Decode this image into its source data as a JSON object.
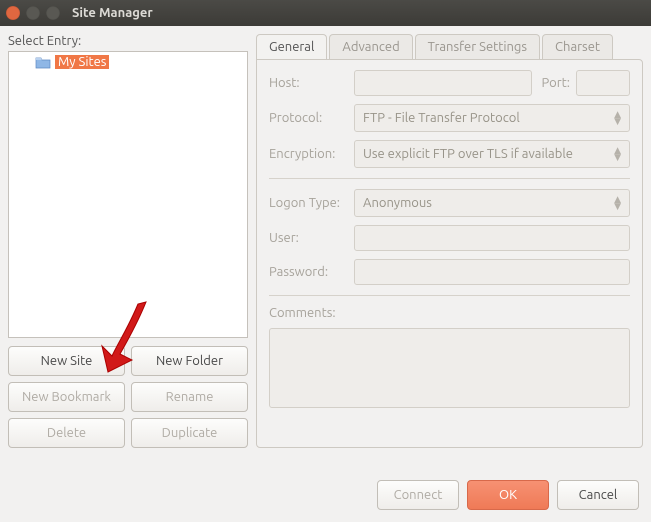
{
  "title": "Site Manager",
  "left": {
    "select_entry_label": "Select Entry:",
    "tree_root": "My Sites",
    "buttons": {
      "new_site": "New Site",
      "new_folder": "New Folder",
      "new_bookmark": "New Bookmark",
      "rename": "Rename",
      "delete": "Delete",
      "duplicate": "Duplicate"
    }
  },
  "tabs": {
    "general": "General",
    "advanced": "Advanced",
    "transfer": "Transfer Settings",
    "charset": "Charset"
  },
  "form": {
    "host_label": "Host:",
    "port_label": "Port:",
    "protocol_label": "Protocol:",
    "protocol_value": "FTP - File Transfer Protocol",
    "encryption_label": "Encryption:",
    "encryption_value": "Use explicit FTP over TLS if available",
    "logon_type_label": "Logon Type:",
    "logon_type_value": "Anonymous",
    "user_label": "User:",
    "password_label": "Password:",
    "comments_label": "Comments:"
  },
  "footer": {
    "connect": "Connect",
    "ok": "OK",
    "cancel": "Cancel"
  }
}
